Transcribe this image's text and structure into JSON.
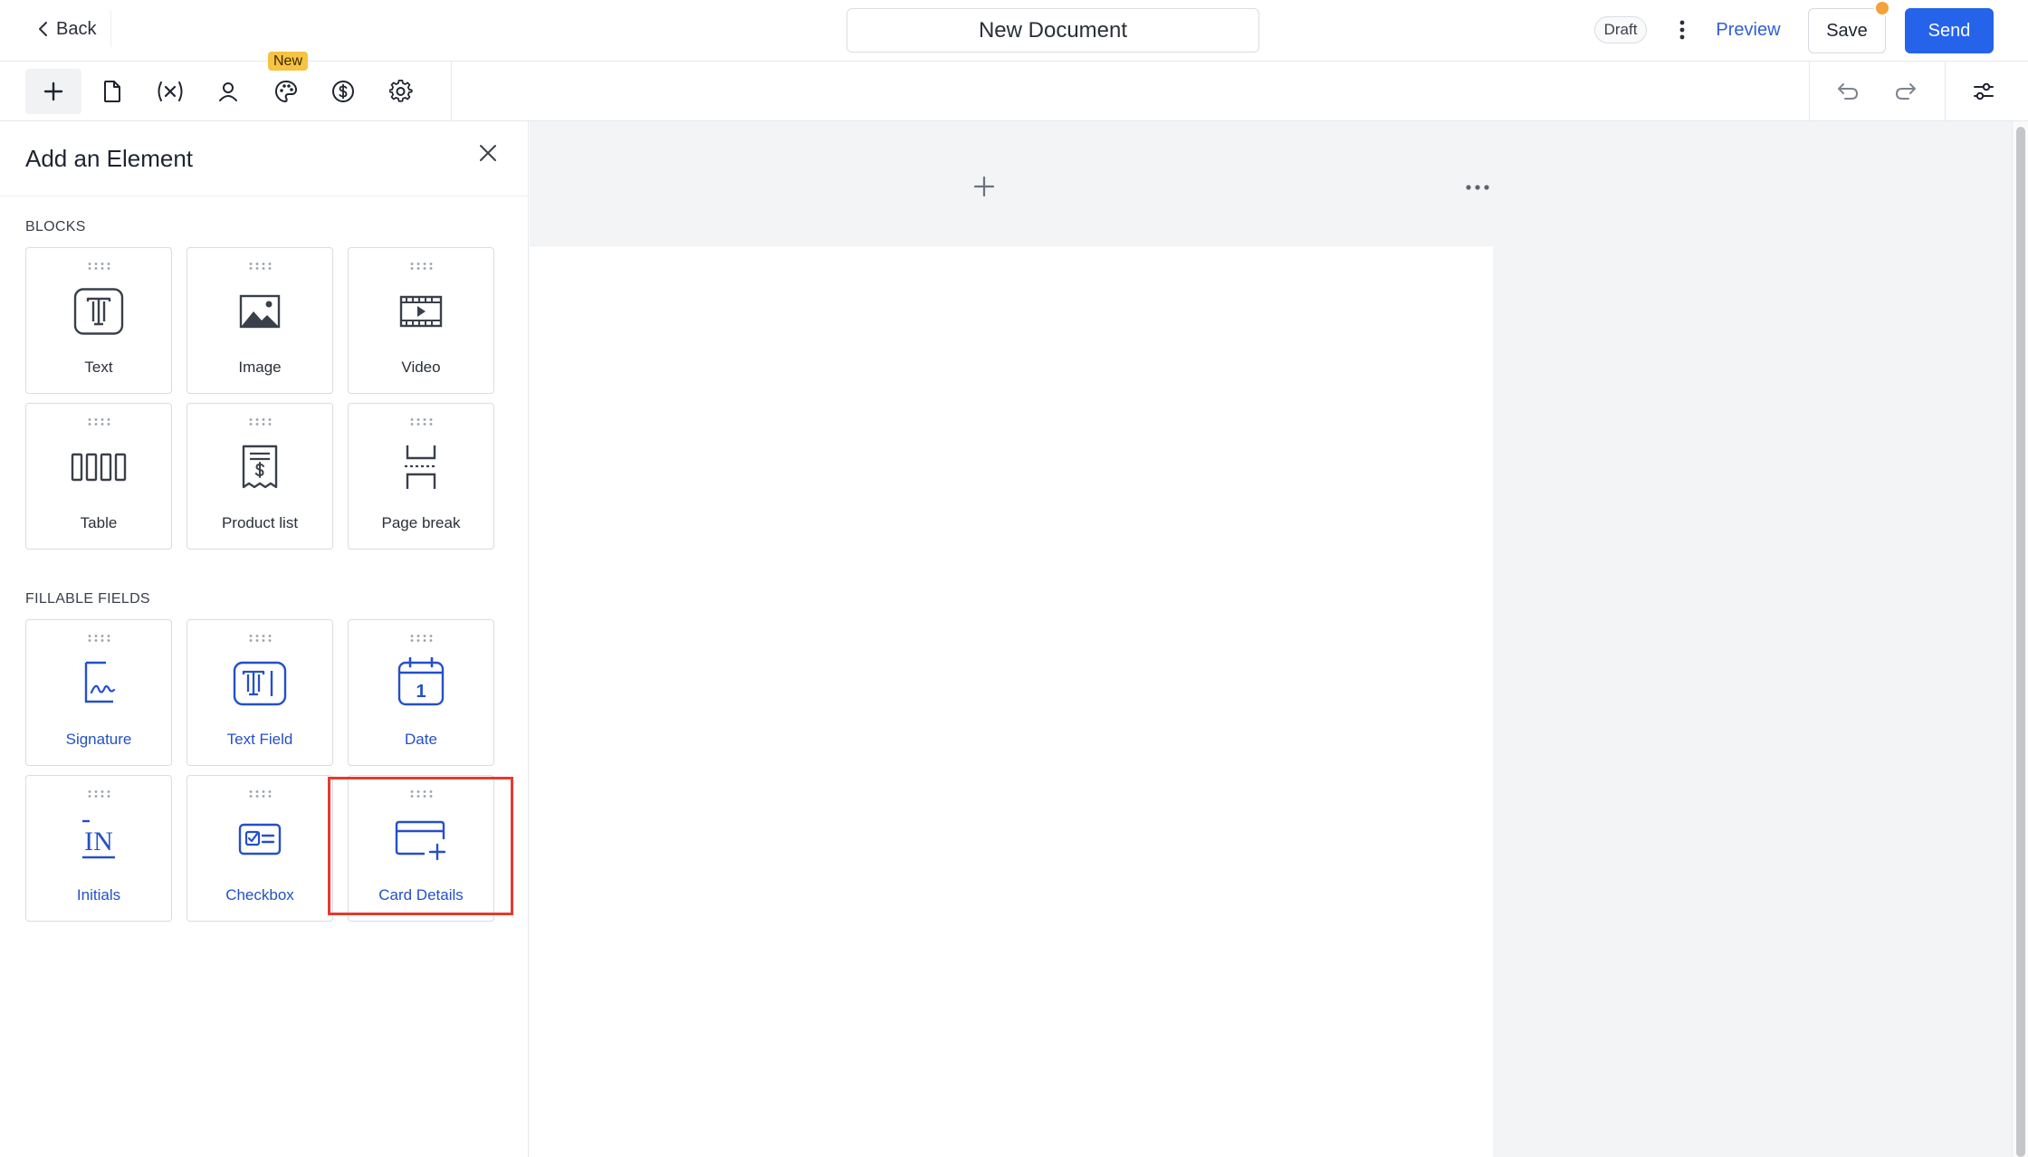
{
  "header": {
    "back_label": "Back",
    "document_title": "New Document",
    "status_badge": "Draft",
    "preview_label": "Preview",
    "save_label": "Save",
    "send_label": "Send"
  },
  "toolbar": {
    "tools": [
      {
        "name": "add",
        "icon": "plus-icon"
      },
      {
        "name": "document",
        "icon": "document-icon"
      },
      {
        "name": "variables",
        "icon": "variable-icon"
      },
      {
        "name": "recipients",
        "icon": "person-icon"
      },
      {
        "name": "design",
        "icon": "palette-icon"
      },
      {
        "name": "pricing",
        "icon": "dollar-circle-icon"
      },
      {
        "name": "settings",
        "icon": "gear-icon"
      }
    ],
    "new_badge": "New",
    "right_tools": [
      "undo-icon",
      "redo-icon",
      "sliders-icon"
    ]
  },
  "panel": {
    "title": "Add an Element",
    "blocks_label": "BLOCKS",
    "blocks": [
      {
        "label": "Text",
        "icon": "text-block-icon"
      },
      {
        "label": "Image",
        "icon": "image-icon"
      },
      {
        "label": "Video",
        "icon": "video-icon"
      },
      {
        "label": "Table",
        "icon": "table-icon"
      },
      {
        "label": "Product list",
        "icon": "receipt-dollar-icon"
      },
      {
        "label": "Page break",
        "icon": "page-break-icon"
      }
    ],
    "fields_label": "FILLABLE FIELDS",
    "fields": [
      {
        "label": "Signature",
        "icon": "signature-icon"
      },
      {
        "label": "Text Field",
        "icon": "text-field-icon"
      },
      {
        "label": "Date",
        "icon": "calendar-icon",
        "day": "1"
      },
      {
        "label": "Initials",
        "icon": "initials-icon",
        "glyph": "IN"
      },
      {
        "label": "Checkbox",
        "icon": "checkbox-icon"
      },
      {
        "label": "Card Details",
        "icon": "card-plus-icon"
      }
    ]
  },
  "colors": {
    "accent": "#2563eb",
    "field_blue": "#2450c8",
    "highlight": "#e53a2f",
    "new_badge": "#f6c342",
    "save_dot": "#f2a33a"
  }
}
